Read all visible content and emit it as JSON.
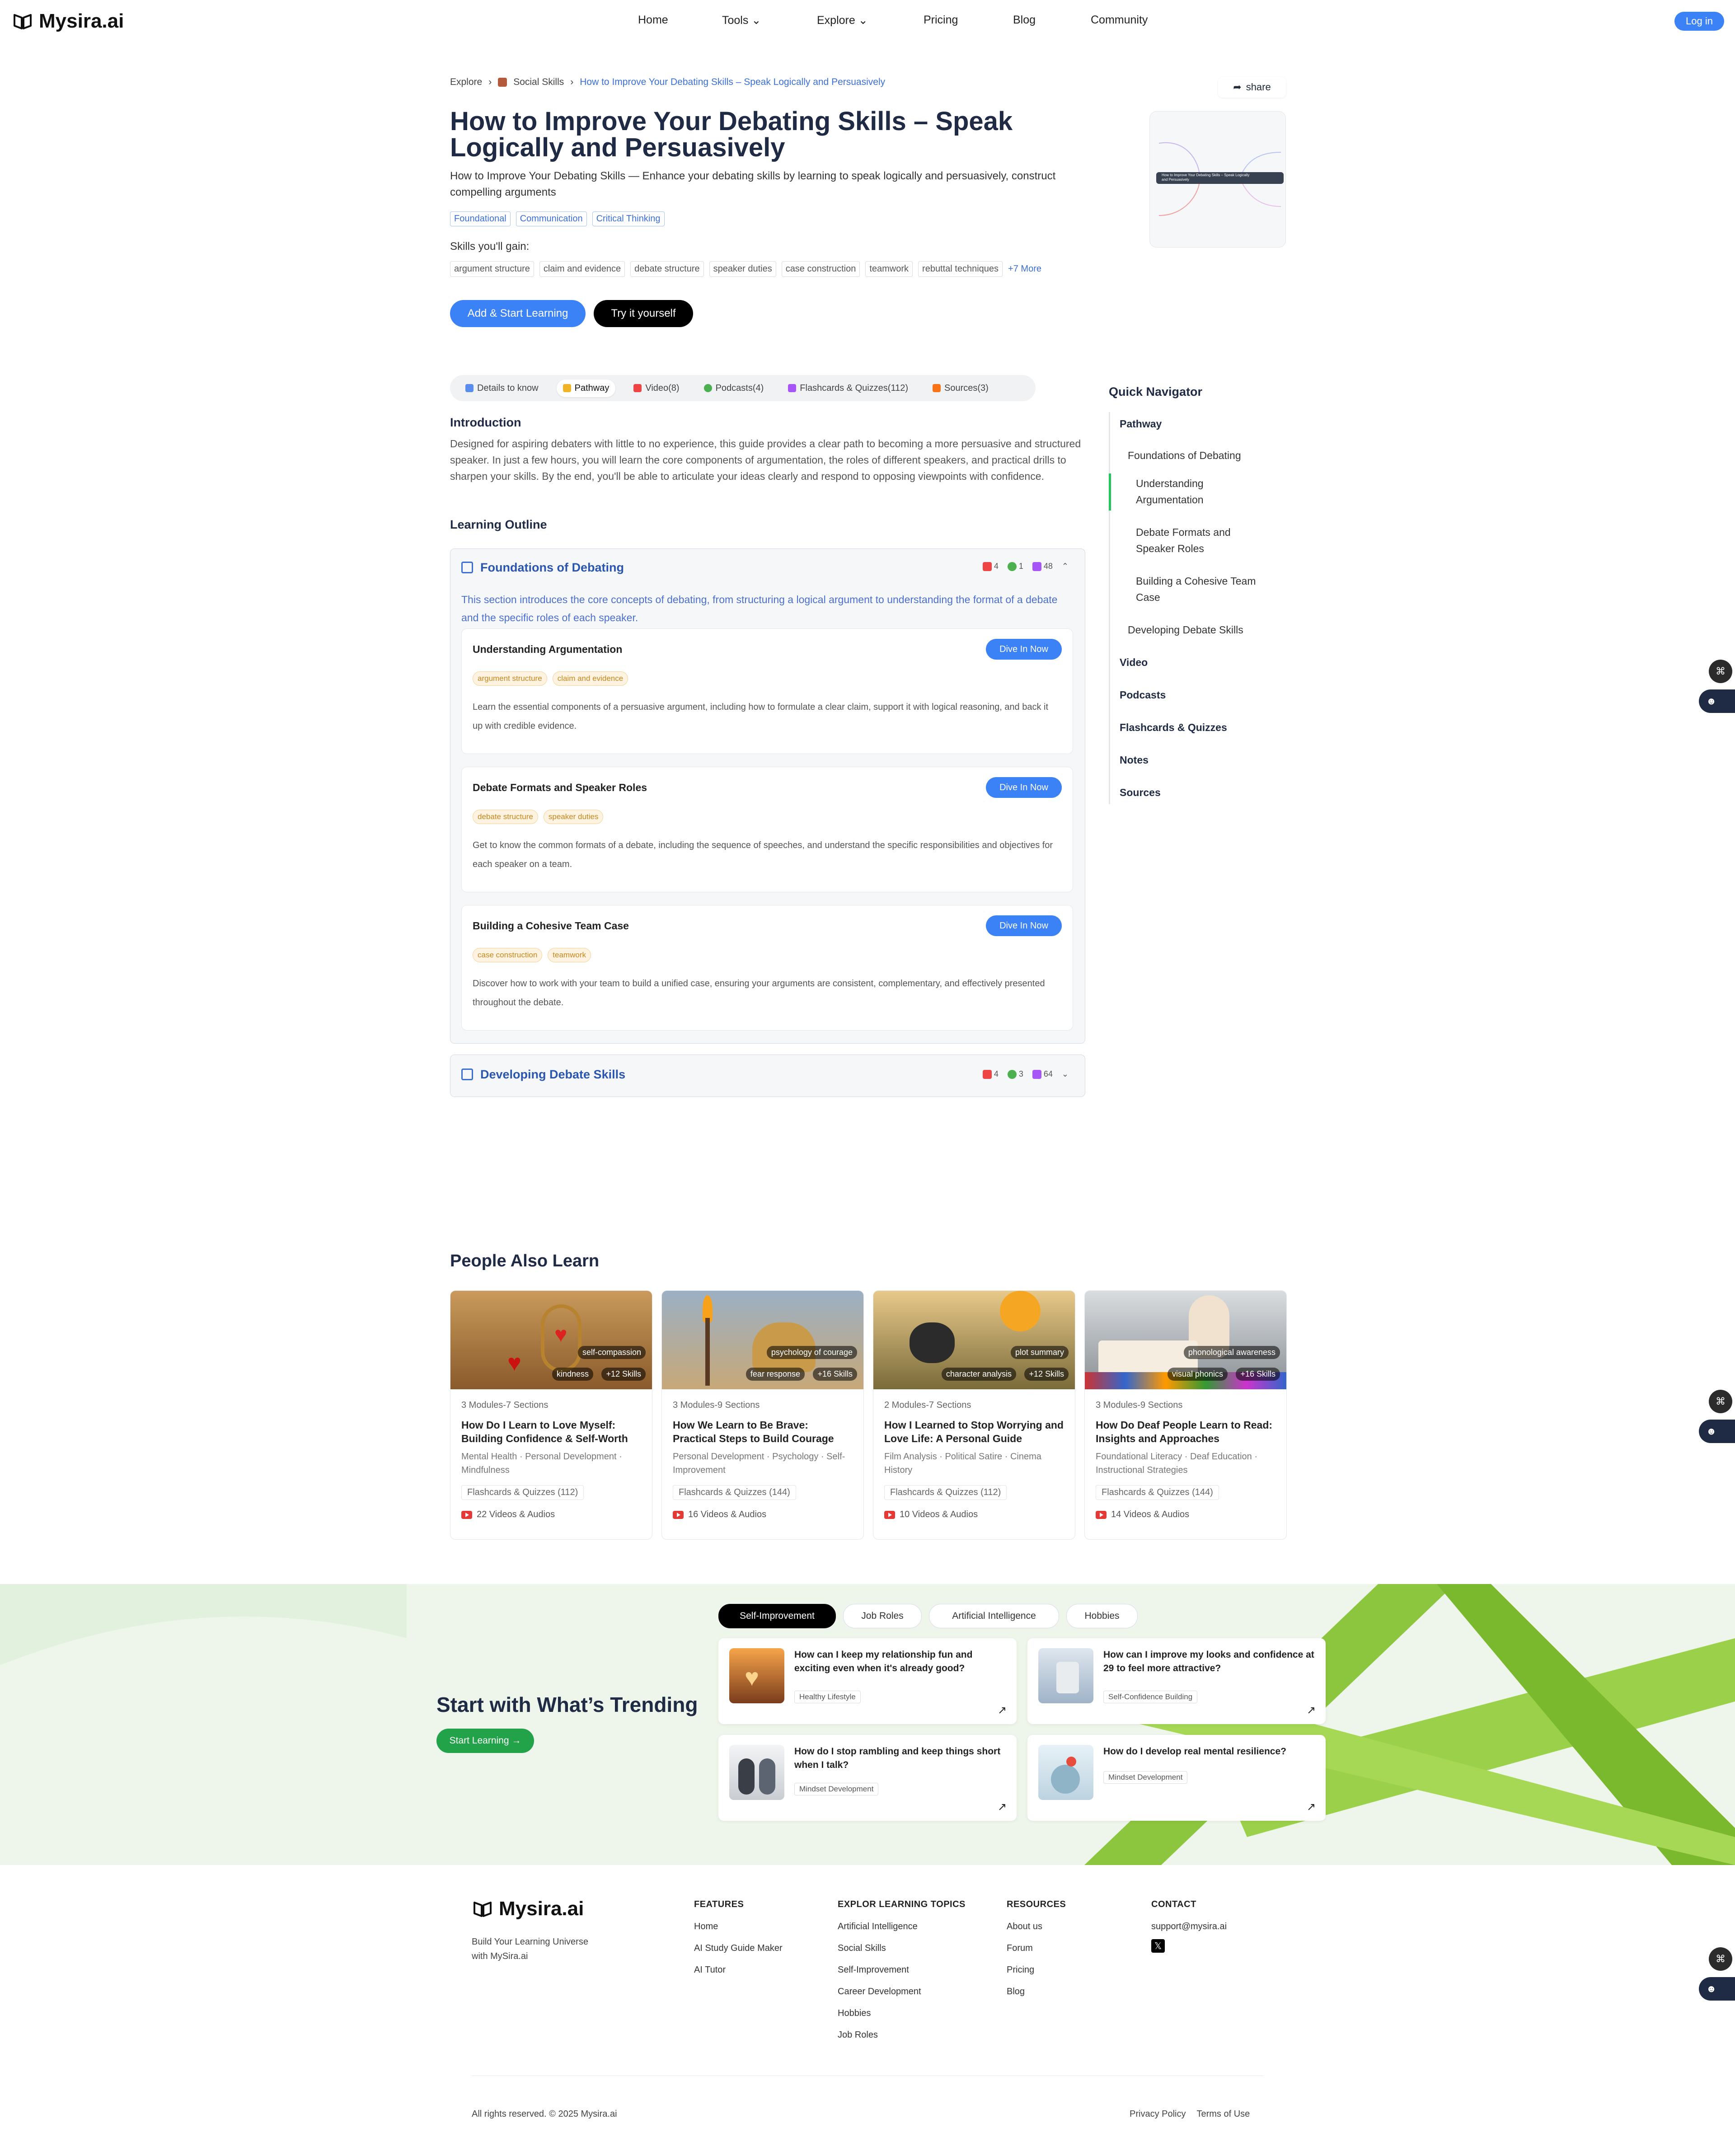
{
  "header": {
    "logo": "Mysira.ai",
    "nav": [
      "Home",
      "Tools",
      "Explore",
      "Pricing",
      "Blog",
      "Community"
    ],
    "login": "Log in"
  },
  "breadcrumb": [
    "Explore",
    "Social Skills",
    "How to Improve Your Debating Skills – Speak Logically and Persuasively"
  ],
  "share": "share",
  "hero": {
    "title": "How to Improve Your Debating Skills – Speak Logically and Persuasively",
    "subtitle": "How to Improve Your Debating Skills — Enhance your debating skills by learning to speak logically and persuasively, construct compelling arguments",
    "tags": [
      "Foundational",
      "Communication",
      "Critical Thinking"
    ],
    "skills_label": "Skills you'll gain:",
    "skills": [
      "argument structure",
      "claim and evidence",
      "debate structure",
      "speaker duties",
      "case construction",
      "teamwork",
      "rebuttal techniques"
    ],
    "skills_more": "+7 More",
    "btn_start": "Add & Start Learning",
    "btn_try": "Try it yourself",
    "thumb_label": "How to Improve Your Debating Skills – Speak Logically and Persuasively"
  },
  "tabs": [
    "Details to know",
    "Pathway",
    "Video(8)",
    "Podcasts(4)",
    "Flashcards & Quizzes(112)",
    "Sources(3)"
  ],
  "intro": {
    "heading": "Introduction",
    "text": "Designed for aspiring debaters with little to no experience, this guide provides a clear path to becoming a more persuasive and structured speaker. In just a few hours, you will learn the core components of argumentation, the roles of different speakers, and practical drills to sharpen your skills. By the end, you'll be able to articulate your ideas clearly and respond to opposing viewpoints with confidence."
  },
  "outline": {
    "heading": "Learning Outline",
    "sections": [
      {
        "title": "Foundations of Debating",
        "stats": {
          "video": "4",
          "podcast": "1",
          "cards": "48"
        },
        "desc": "This section introduces the core concepts of debating, from structuring a logical argument to understanding the format of a debate and the specific roles of each speaker.",
        "items": [
          {
            "title": "Understanding Argumentation",
            "tags": [
              "argument structure",
              "claim and evidence"
            ],
            "desc": "Learn the essential components of a persuasive argument, including how to formulate a clear claim, support it with logical reasoning, and back it up with credible evidence."
          },
          {
            "title": "Debate Formats and Speaker Roles",
            "tags": [
              "debate structure",
              "speaker duties"
            ],
            "desc": "Get to know the common formats of a debate, including the sequence of speeches, and understand the specific responsibilities and objectives for each speaker on a team."
          },
          {
            "title": "Building a Cohesive Team Case",
            "tags": [
              "case construction",
              "teamwork"
            ],
            "desc": "Discover how to work with your team to build a unified case, ensuring your arguments are consistent, complementary, and effectively presented throughout the debate."
          }
        ]
      },
      {
        "title": "Developing Debate Skills",
        "stats": {
          "video": "4",
          "podcast": "3",
          "cards": "64"
        }
      }
    ],
    "dive": "Dive In Now"
  },
  "navigator": {
    "title": "Quick Navigator",
    "items": [
      "Pathway",
      "Foundations of Debating",
      "Understanding Argumentation",
      "Debate Formats and Speaker Roles",
      "Building a Cohesive Team Case",
      "Developing Debate Skills",
      "Video",
      "Podcasts",
      "Flashcards & Quizzes",
      "Notes",
      "Sources"
    ]
  },
  "people_also_learn": {
    "heading": "People Also Learn",
    "cards": [
      {
        "badges_top": "self-compassion",
        "badges_bottom": [
          "kindness",
          "+12 Skills"
        ],
        "meta": "3 Modules-7 Sections",
        "title": "How Do I Learn to Love Myself: Building Confidence & Self-Worth",
        "cats": "Mental Health · Personal Development · Mindfulness",
        "flash": "Flashcards & Quizzes (112)",
        "videos": "22 Videos & Audios"
      },
      {
        "badges_top": "psychology of courage",
        "badges_bottom": [
          "fear response",
          "+16 Skills"
        ],
        "meta": "3 Modules-9 Sections",
        "title": "How We Learn to Be Brave: Practical Steps to Build Courage",
        "cats": "Personal Development · Psychology · Self-Improvement",
        "flash": "Flashcards & Quizzes (144)",
        "videos": "16 Videos & Audios"
      },
      {
        "badges_top": "plot summary",
        "badges_bottom": [
          "character analysis",
          "+12 Skills"
        ],
        "meta": "2 Modules-7 Sections",
        "title": "How I Learned to Stop Worrying and Love Life: A Personal Guide",
        "cats": "Film Analysis · Political Satire · Cinema History",
        "flash": "Flashcards & Quizzes (112)",
        "videos": "10 Videos & Audios"
      },
      {
        "badges_top": "phonological awareness",
        "badges_bottom": [
          "visual phonics",
          "+16 Skills"
        ],
        "meta": "3 Modules-9 Sections",
        "title": "How Do Deaf People Learn to Read: Insights and Approaches",
        "cats": "Foundational Literacy · Deaf Education · Instructional Strategies",
        "flash": "Flashcards & Quizzes (144)",
        "videos": "14 Videos & Audios"
      }
    ]
  },
  "trending": {
    "heading": "Start with What’s Trending",
    "button": "Start Learning →",
    "chips": [
      "Self-Improvement",
      "Job Roles",
      "Artificial Intelligence",
      "Hobbies"
    ],
    "cards": [
      {
        "q": "How can I keep my relationship fun and exciting even when it's already good?",
        "tag": "Healthy Lifestyle"
      },
      {
        "q": "How can I improve my looks and confidence at 29 to feel more attractive?",
        "tag": "Self-Confidence Building"
      },
      {
        "q": "How do I stop rambling and keep things short when I talk?",
        "tag": "Mindset Development"
      },
      {
        "q": "How do I develop real mental resilience?",
        "tag": "Mindset Development"
      }
    ]
  },
  "footer": {
    "logo": "Mysira.ai",
    "tagline": "Build Your Learning Universe with MySira.ai",
    "cols": [
      {
        "h": "FEATURES",
        "links": [
          "Home",
          "AI Study Guide Maker",
          "AI Tutor"
        ]
      },
      {
        "h": "EXPLOR LEARNING TOPICS",
        "links": [
          "Artificial Intelligence",
          "Social Skills",
          "Self-Improvement",
          "Career Development",
          "Hobbies",
          "Job Roles"
        ]
      },
      {
        "h": "RESOURCES",
        "links": [
          "About us",
          "Forum",
          "Pricing",
          "Blog"
        ]
      },
      {
        "h": "CONTACT",
        "links": [
          "support@mysira.ai"
        ]
      }
    ],
    "copyright": "All rights reserved. © 2025 Mysira.ai",
    "legal": [
      "Privacy Policy",
      "Terms of Use"
    ]
  }
}
